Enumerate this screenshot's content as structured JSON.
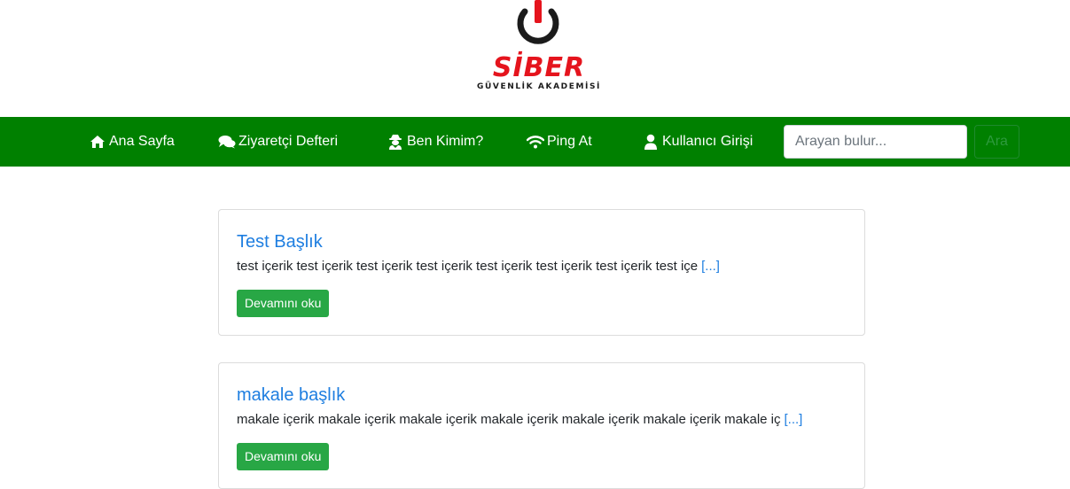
{
  "logo": {
    "title": "SİBER",
    "subtitle": "GÜVENLİK AKADEMİSİ",
    "icon": "power-icon",
    "colors": {
      "red": "#e5141d",
      "dark": "#1b1b1b"
    }
  },
  "nav": {
    "background": "#008000",
    "items": [
      {
        "label": "Ana Sayfa",
        "icon": "home-icon"
      },
      {
        "label": "Ziyaretçi Defteri",
        "icon": "comments-icon"
      },
      {
        "label": "Ben Kimim?",
        "icon": "user-secret-icon"
      },
      {
        "label": "Ping At",
        "icon": "wifi-icon"
      },
      {
        "label": "Kullanıcı Girişi",
        "icon": "user-icon"
      }
    ]
  },
  "search": {
    "placeholder": "Arayan bulur...",
    "value": "",
    "button_label": "Ara"
  },
  "posts": [
    {
      "title": "Test Başlık",
      "excerpt": "test içerik test içerik test içerik test içerik test içerik test içerik test içerik test içe",
      "more": "[...]",
      "button_label": "Devamını oku"
    },
    {
      "title": "makale başlık",
      "excerpt": "makale içerik makale içerik makale içerik makale içerik makale içerik makale içerik makale iç",
      "more": "[...]",
      "button_label": "Devamını oku"
    }
  ]
}
